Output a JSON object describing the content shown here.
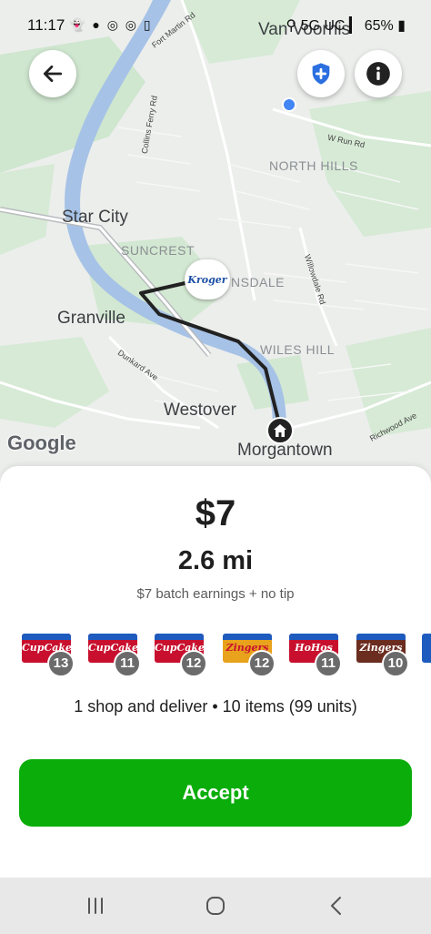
{
  "status_bar": {
    "time": "11:17",
    "notification_icons": [
      "snapchat-icon",
      "chat-icon",
      "messenger-icon",
      "messenger-icon",
      "phone-icon"
    ],
    "network": "5G UC",
    "battery": "65%"
  },
  "map": {
    "labels": {
      "van_voorhis": "Van Voorhis",
      "star_city": "Star City",
      "suncrest": "SUNCREST",
      "north_hills": "NORTH HILLS",
      "nsdale": "NSDALE",
      "granville": "Granville",
      "wiles_hill": "WILES HILL",
      "westover": "Westover",
      "morgantown": "Morgantown"
    },
    "roads": {
      "fort_martin": "Fort Martin Rd",
      "collins_ferry": "Collins Ferry Rd",
      "w_run": "W Run Rd",
      "willowdale": "Willowdale Rd",
      "dunkard": "Dunkard Ave",
      "richwood": "Richwood Ave"
    },
    "store": "Kroger",
    "attribution": "Google",
    "colors": {
      "water": "#a6c2e6",
      "park": "#cfe6cf",
      "land": "#eceeec",
      "route": "#222222"
    }
  },
  "header": {
    "back_icon": "arrow-left-icon",
    "safety_icon": "shield-plus-icon",
    "info_icon": "info-icon"
  },
  "offer": {
    "price": "$7",
    "distance": "2.6 mi",
    "earnings_note": "$7 batch earnings + no tip",
    "items": [
      {
        "brand": "CupCakes",
        "qty": "13",
        "color": "#c8102e"
      },
      {
        "brand": "CupCakes",
        "qty": "11",
        "color": "#c8102e"
      },
      {
        "brand": "CupCakes",
        "qty": "12",
        "color": "#c8102e"
      },
      {
        "brand": "Zingers",
        "qty": "12",
        "color": "#e8a21c"
      },
      {
        "brand": "HoHos",
        "qty": "11",
        "color": "#c8102e"
      },
      {
        "brand": "Zingers",
        "qty": "10",
        "color": "#6b2d1f"
      }
    ],
    "summary": "1 shop and deliver • 10 items (99 units)",
    "accept_label": "Accept",
    "accept_color": "#0aad0a"
  },
  "navbar": {
    "recents_icon": "recents-icon",
    "home_icon": "home-circle-icon",
    "back_icon": "chevron-left-icon"
  }
}
